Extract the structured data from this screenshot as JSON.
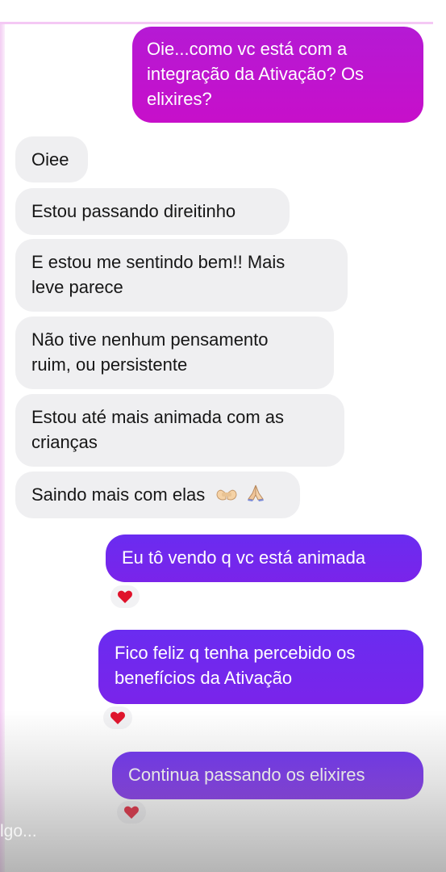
{
  "conversation": {
    "messages": [
      {
        "id": "m1",
        "side": "sent",
        "lines": [
          "Oie...como vc está com a",
          "integração da Ativação? Os",
          "elixires?"
        ]
      },
      {
        "id": "m2",
        "side": "received",
        "lines": [
          "Oiee"
        ]
      },
      {
        "id": "m3",
        "side": "received",
        "lines": [
          "Estou passando direitinho"
        ]
      },
      {
        "id": "m4",
        "side": "received",
        "lines": [
          "E estou me sentindo bem!! Mais",
          "leve parece"
        ]
      },
      {
        "id": "m5",
        "side": "received",
        "lines": [
          "Não tive nenhum pensamento",
          "ruim, ou persistente"
        ]
      },
      {
        "id": "m6",
        "side": "received",
        "lines": [
          "Estou até mais animada com as",
          "crianças"
        ]
      },
      {
        "id": "m7",
        "side": "received",
        "lines": [
          "Saindo mais com elas"
        ],
        "emojis": [
          "hands-clapping",
          "folded-hands"
        ]
      },
      {
        "id": "m8",
        "side": "sent",
        "lines": [
          "Eu tô vendo q vc está animada"
        ],
        "reaction": "heart"
      },
      {
        "id": "m9",
        "side": "sent",
        "lines": [
          "Fico feliz q tenha percebido os",
          "benefícios da Ativação"
        ],
        "reaction": "heart"
      },
      {
        "id": "m10",
        "side": "sent",
        "lines": [
          "Continua passando os elixires"
        ],
        "reaction": "heart"
      }
    ]
  },
  "composer": {
    "placeholder_fragment": "lgo..."
  },
  "colors": {
    "sent_magenta": "#c015d0",
    "sent_violet": "#6f28ee",
    "received_bubble": "#efeff1",
    "reaction_heart": "#e0122a"
  }
}
